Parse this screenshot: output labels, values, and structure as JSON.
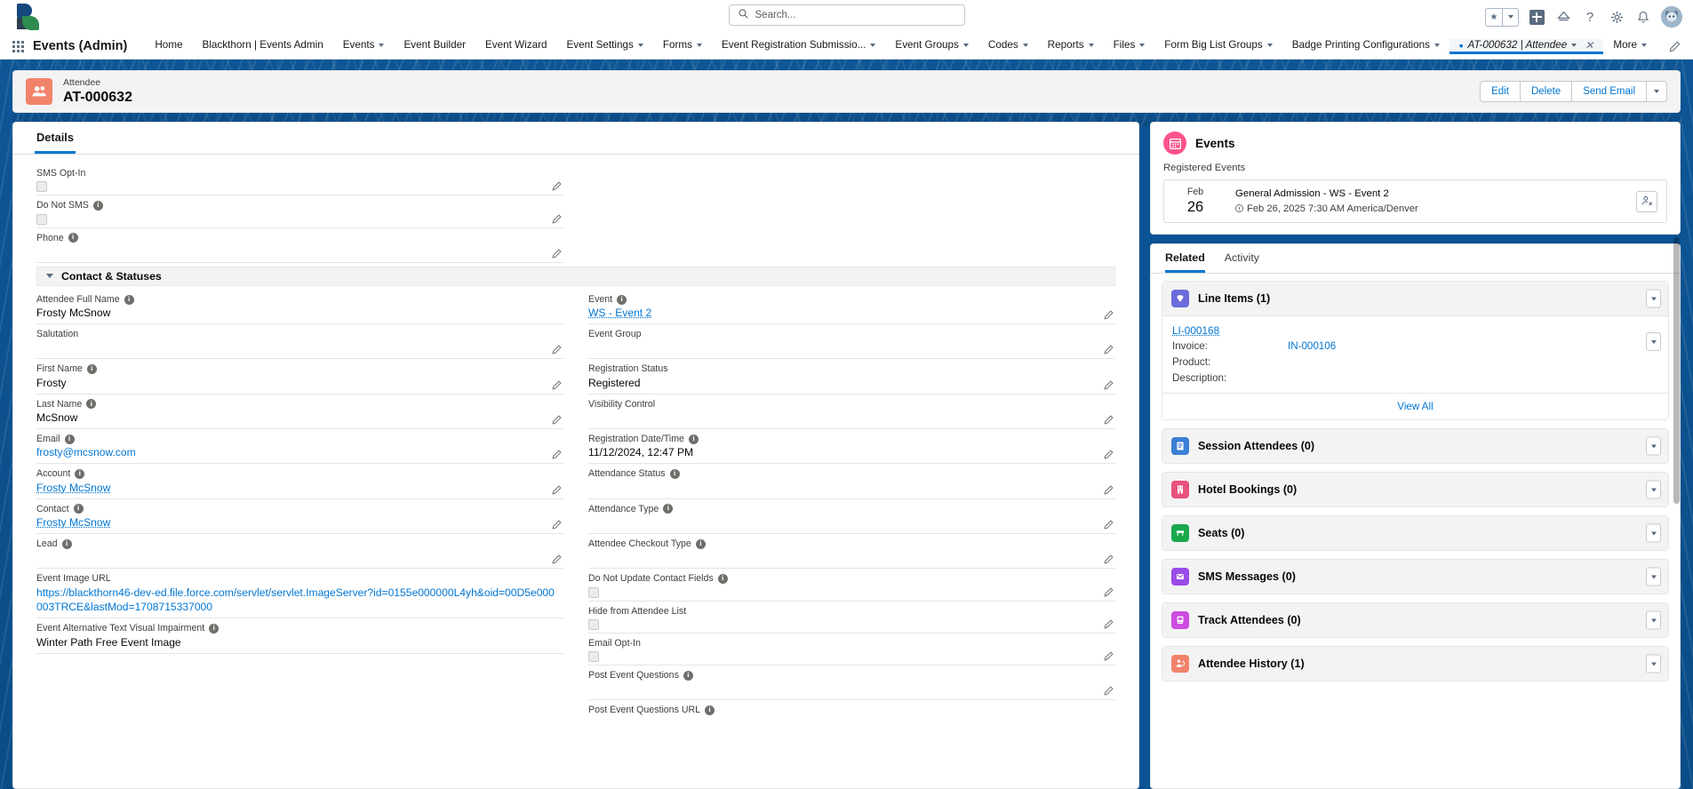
{
  "header": {
    "logo_name": "blackthorn-logo",
    "search": {
      "placeholder": "Search...",
      "value": ""
    },
    "icons": [
      "favorites-star-icon",
      "favorites-caret-icon",
      "add-icon",
      "setup-assistant-icon",
      "help-icon",
      "setup-gear-icon",
      "notifications-bell-icon",
      "user-avatar"
    ]
  },
  "nav": {
    "app_name": "Events (Admin)",
    "items": [
      {
        "label": "Home",
        "caret": false
      },
      {
        "label": "Blackthorn | Events Admin",
        "caret": false
      },
      {
        "label": "Events",
        "caret": true
      },
      {
        "label": "Event Builder",
        "caret": false
      },
      {
        "label": "Event Wizard",
        "caret": false
      },
      {
        "label": "Event Settings",
        "caret": true
      },
      {
        "label": "Forms",
        "caret": true
      },
      {
        "label": "Event Registration Submissio...",
        "caret": true
      },
      {
        "label": "Event Groups",
        "caret": true
      },
      {
        "label": "Codes",
        "caret": true
      },
      {
        "label": "Reports",
        "caret": true
      },
      {
        "label": "Files",
        "caret": true
      },
      {
        "label": "Form Big List Groups",
        "caret": true
      },
      {
        "label": "Badge Printing Configurations",
        "caret": true
      }
    ],
    "active_tab": {
      "dot": "•",
      "label": "AT-000632 | Attendee",
      "close": "✕"
    },
    "more_label": "More"
  },
  "record": {
    "object_type": "Attendee",
    "name": "AT-000632",
    "icon": "attendee-people-icon",
    "actions": [
      "Edit",
      "Delete",
      "Send Email"
    ]
  },
  "details": {
    "tabs": [
      {
        "label": "Details",
        "active": true
      }
    ],
    "top_fields": [
      {
        "label": "SMS Opt-In",
        "info": false,
        "type": "checkbox",
        "value": ""
      },
      {
        "label": "Do Not SMS",
        "info": true,
        "type": "checkbox",
        "value": ""
      },
      {
        "label": "Phone",
        "info": true,
        "type": "text",
        "value": ""
      }
    ],
    "section_title": "Contact & Statuses",
    "left_fields": [
      {
        "label": "Attendee Full Name",
        "info": true,
        "type": "text",
        "value": "Frosty McSnow",
        "pencil": false
      },
      {
        "label": "Salutation",
        "info": false,
        "type": "text",
        "value": "",
        "pencil": true
      },
      {
        "label": "First Name",
        "info": true,
        "type": "text",
        "value": "Frosty",
        "pencil": true
      },
      {
        "label": "Last Name",
        "info": true,
        "type": "text",
        "value": "McSnow",
        "pencil": true
      },
      {
        "label": "Email",
        "info": true,
        "type": "link",
        "value": "frosty@mcsnow.com",
        "pencil": true
      },
      {
        "label": "Account",
        "info": true,
        "type": "linkdot",
        "value": "Frosty McSnow",
        "pencil": true
      },
      {
        "label": "Contact",
        "info": true,
        "type": "linkdot",
        "value": "Frosty McSnow",
        "pencil": true
      },
      {
        "label": "Lead",
        "info": true,
        "type": "text",
        "value": "",
        "pencil": true
      },
      {
        "label": "Event Image URL",
        "info": false,
        "type": "link",
        "value": "https://blackthorn46-dev-ed.file.force.com/servlet/servlet.ImageServer?id=0155e000000L4yh&oid=00D5e000003TRCE&lastMod=1708715337000",
        "pencil": false
      },
      {
        "label": "Event Alternative Text Visual Impairment",
        "info": true,
        "type": "text",
        "value": "Winter Path Free Event Image",
        "pencil": false
      }
    ],
    "right_fields": [
      {
        "label": "Event",
        "info": true,
        "type": "linkdot",
        "value": "WS - Event 2",
        "pencil": true
      },
      {
        "label": "Event Group",
        "info": false,
        "type": "text",
        "value": "",
        "pencil": true
      },
      {
        "label": "Registration Status",
        "info": false,
        "type": "text",
        "value": "Registered",
        "pencil": true
      },
      {
        "label": "Visibility Control",
        "info": false,
        "type": "text",
        "value": "",
        "pencil": true
      },
      {
        "label": "Registration Date/Time",
        "info": true,
        "type": "text",
        "value": "11/12/2024, 12:47 PM",
        "pencil": true
      },
      {
        "label": "Attendance Status",
        "info": true,
        "type": "text",
        "value": "",
        "pencil": true
      },
      {
        "label": "Attendance Type",
        "info": true,
        "type": "text",
        "value": "",
        "pencil": true
      },
      {
        "label": "Attendee Checkout Type",
        "info": true,
        "type": "text",
        "value": "",
        "pencil": true
      },
      {
        "label": "Do Not Update Contact Fields",
        "info": true,
        "type": "checkbox",
        "value": "",
        "pencil": true
      },
      {
        "label": "Hide from Attendee List",
        "info": false,
        "type": "checkbox",
        "value": "",
        "pencil": true
      },
      {
        "label": "Email Opt-In",
        "info": false,
        "type": "checkbox",
        "value": "",
        "pencil": true
      },
      {
        "label": "Post Event Questions",
        "info": true,
        "type": "text",
        "value": "",
        "pencil": true
      },
      {
        "label": "Post Event Questions URL",
        "info": true,
        "type": "text",
        "value": "",
        "pencil": false
      }
    ]
  },
  "events_panel": {
    "title": "Events",
    "icon": "calendar-icon",
    "subtitle": "Registered Events",
    "rows": [
      {
        "month": "Feb",
        "day": "26",
        "name": "General Admission - WS - Event 2",
        "time": "Feb 26, 2025 7:30 AM America/Denver",
        "action_icon": "check-out-attendee-icon"
      }
    ]
  },
  "related": {
    "tabs": [
      {
        "label": "Related",
        "active": true
      },
      {
        "label": "Activity",
        "active": false
      }
    ],
    "lists": [
      {
        "title": "Line Items (1)",
        "icon": "line-item-diamond-icon",
        "color": "#6b6bdb",
        "expanded": true,
        "record": {
          "link": "LI-000168",
          "rows": [
            {
              "key": "Invoice:",
              "value": "IN-000106",
              "is_link": true
            },
            {
              "key": "Product:",
              "value": "",
              "is_link": false
            },
            {
              "key": "Description:",
              "value": "",
              "is_link": false
            }
          ]
        },
        "view_all": "View All"
      },
      {
        "title": "Session Attendees (0)",
        "icon": "session-attendee-icon",
        "color": "#3b7fd4",
        "expanded": false
      },
      {
        "title": "Hotel Bookings (0)",
        "icon": "hotel-icon",
        "color": "#e8527e",
        "expanded": false
      },
      {
        "title": "Seats (0)",
        "icon": "seat-icon",
        "color": "#1aa84f",
        "expanded": false
      },
      {
        "title": "SMS Messages (0)",
        "icon": "sms-envelope-icon",
        "color": "#9a4ce8",
        "expanded": false
      },
      {
        "title": "Track Attendees (0)",
        "icon": "track-attendee-icon",
        "color": "#cc4ce0",
        "expanded": false
      },
      {
        "title": "Attendee History (1)",
        "icon": "attendee-history-icon",
        "color": "#f2836b",
        "expanded": false
      }
    ]
  },
  "colors": {
    "brand_blue": "#0176d3",
    "banner_blue": "#0b5394",
    "record_icon": "#f2836b",
    "events_icon": "#ff538a"
  }
}
